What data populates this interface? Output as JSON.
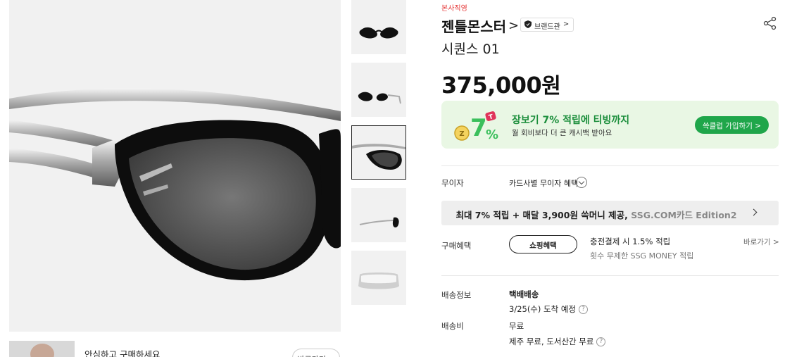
{
  "gallery": {
    "main_image_icon": "sunglasses-closeup-image",
    "thumbnails": [
      {
        "icon": "sunglasses-front-thumb",
        "active": false
      },
      {
        "icon": "sunglasses-angle-thumb",
        "active": false
      },
      {
        "icon": "sunglasses-closeup-thumb",
        "active": true
      },
      {
        "icon": "sunglasses-side-thumb",
        "active": false
      },
      {
        "icon": "case-thumb",
        "active": false
      }
    ]
  },
  "seller": {
    "safe_text": "안심하고 구매하세요",
    "button_label": "바로가기 >"
  },
  "product": {
    "tag": "본사직영",
    "brand": "젠틀몬스터",
    "brand_chevron": ">",
    "brand_hall": "브랜드관",
    "brand_hall_chevron": ">",
    "name": "시퀀스 01",
    "price_number": "375,000",
    "price_unit": "원"
  },
  "promo": {
    "title": "장보기 7% 적립에 티빙까지",
    "subtitle": "월 회비보다 더 큰 캐시백 받아요",
    "button_label": "쓱클럽 가입하기 >",
    "accent": "#1fa64a",
    "background": "#e9f7e4"
  },
  "installment": {
    "label": "무이자",
    "text": "카드사별 무이자 혜택"
  },
  "card_banner": {
    "text_main": "최대 7% 적립 + 매달 3,900원 쓱머니 제공, ",
    "text_gray": "SSG.COM카드 Edition2"
  },
  "benefit": {
    "label": "구매혜택",
    "button_label": "쇼핑혜택",
    "title": "충전결제 시 1.5% 적립",
    "subtitle": "횟수 무제한 SSG MONEY 적립",
    "shortcut": "바로가기 >"
  },
  "shipping": {
    "label": "배송정보",
    "type": "택배배송",
    "arrival": "3/25(수) 도착 예정",
    "fee_label": "배송비",
    "fee": "무료",
    "fee_extra": "제주 무료, 도서산간 무료"
  }
}
